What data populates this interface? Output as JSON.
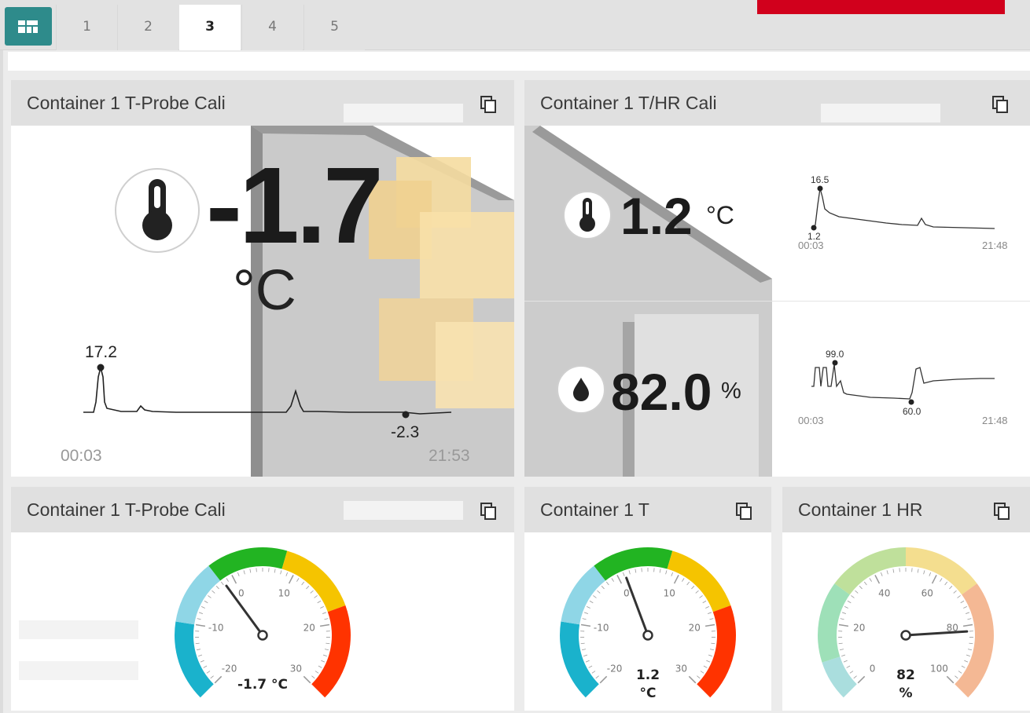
{
  "tabs": [
    "1",
    "2",
    "3",
    "4",
    "5"
  ],
  "active_tab": "3",
  "colors": {
    "accent": "#2e8b8b",
    "brand_red": "#d1001c",
    "gauge_cyan": "#1ab2cc",
    "gauge_green": "#22b422",
    "gauge_yellow": "#f5c400",
    "gauge_red": "#ff3300"
  },
  "panel_tprobe": {
    "title": "Container 1 T-Probe Cali",
    "value": "-1.7",
    "unit": "°C",
    "chart_data": {
      "type": "line",
      "max_label": "17.2",
      "min_label": "-2.3",
      "x_start": "00:03",
      "x_end": "21:53"
    }
  },
  "panel_thr": {
    "title": "Container 1 T/HR Cali",
    "temp_value": "1.2",
    "temp_unit": "°C",
    "hr_value": "82.0",
    "hr_unit": "%",
    "temp_chart": {
      "type": "line",
      "max_label": "16.5",
      "min_label": "1.2",
      "x_start": "00:03",
      "x_end": "21:48"
    },
    "hr_chart": {
      "type": "line",
      "max_label": "99.0",
      "min_label": "60.0",
      "x_start": "00:03",
      "x_end": "21:48"
    }
  },
  "gauge_tprobe": {
    "title": "Container 1 T-Probe Cali",
    "value": -1.7,
    "value_text": "-1.7 °C",
    "ticks": [
      "-20",
      "-10",
      "0",
      "10",
      "20",
      "30"
    ]
  },
  "gauge_t": {
    "title": "Container 1 T",
    "value": 1.2,
    "value_text": "1.2",
    "unit": "°C",
    "ticks": [
      "-20",
      "-10",
      "0",
      "10",
      "20",
      "30"
    ]
  },
  "gauge_hr": {
    "title": "Container 1 HR",
    "value": 82,
    "value_text": "82",
    "unit": "%",
    "ticks": [
      "0",
      "20",
      "40",
      "60",
      "80",
      "100"
    ]
  }
}
